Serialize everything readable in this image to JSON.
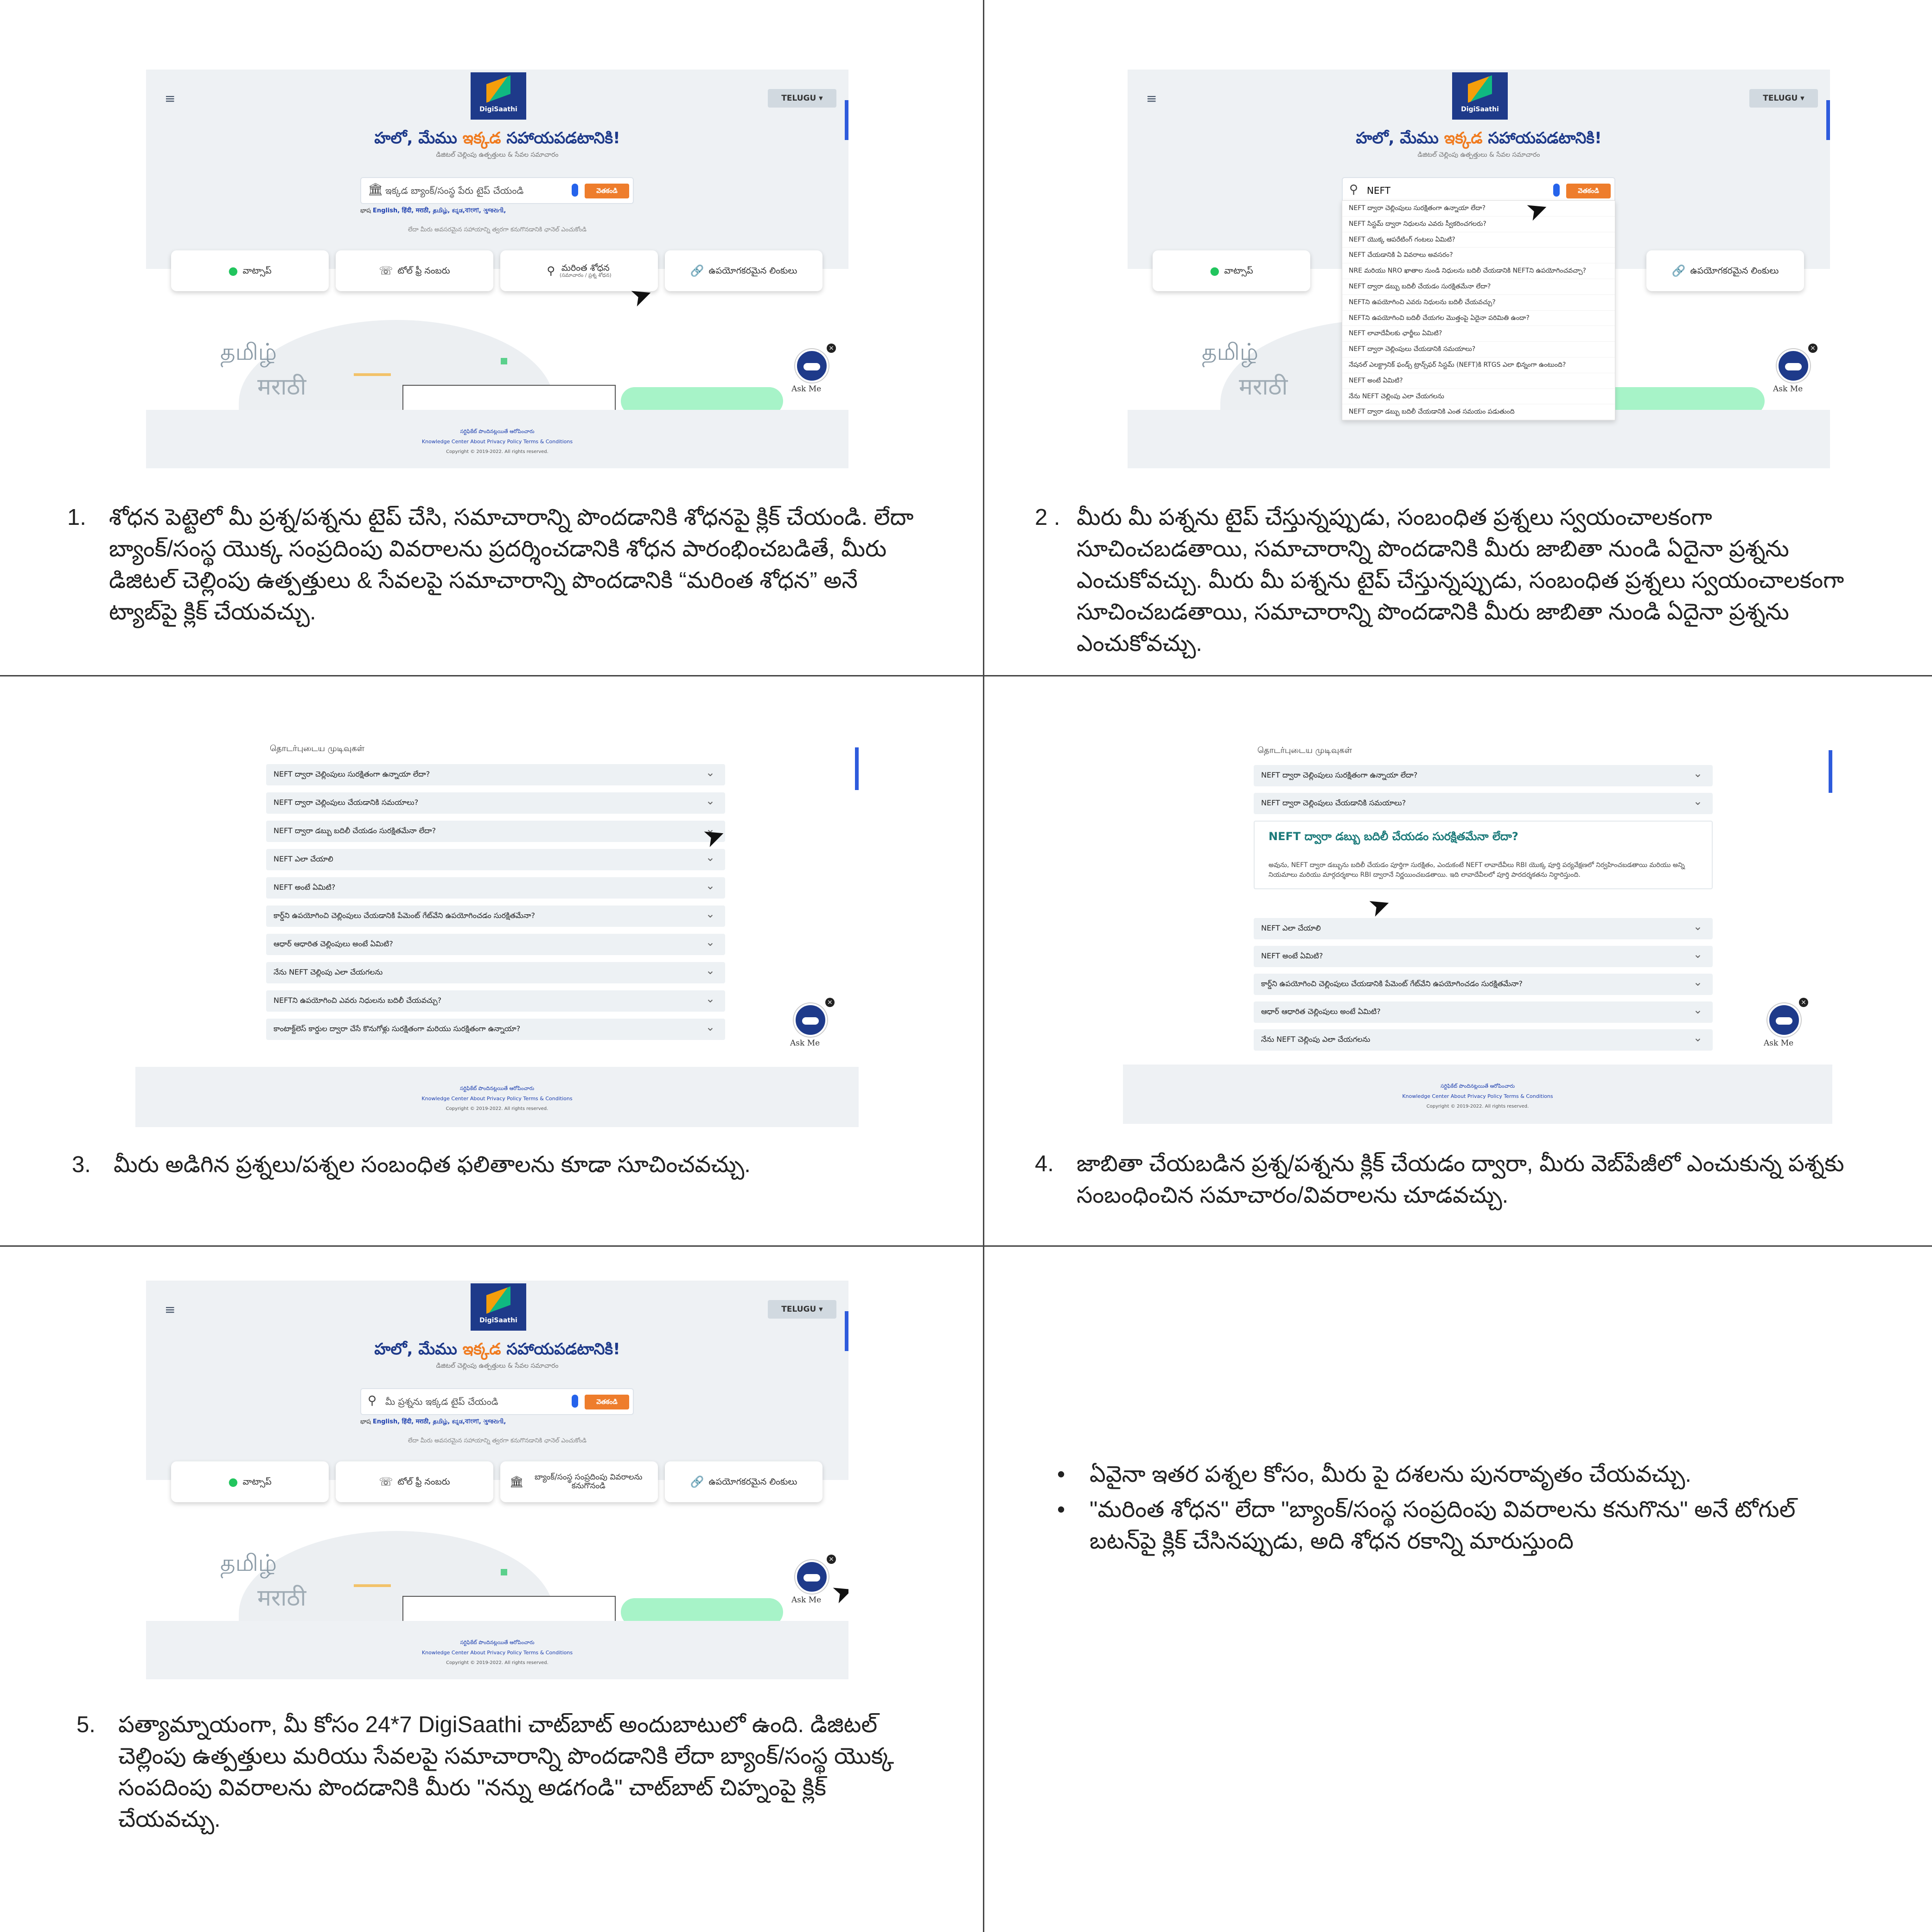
{
  "app": {
    "logo_text": "DigiSaathi",
    "lang_label": "TELUGU ▾",
    "hello_prefix": "హలో, మేము",
    "hello_highlight": "ఇక్కడ",
    "hello_suffix": "సహాయపడటానికి!",
    "subtitle": "డిజిటల్ చెల్లింపు ఉత్పత్తులు & సేవల సమాచారం",
    "search_button": "వెతకండి",
    "lang_prefix": "భాష",
    "langs": "English, हिंदी, मराठी, தமிழ், ಕನ್ನಡ,বাংলা, ગુજરાતી,",
    "hint": "లేదా మీరు అవసరమైన సహాయాన్ని త్వరగా కనుగొనడానికి ఛానెల్ ఎంచుకోండి",
    "btn_whatsapp": "వాట్సాప్",
    "btn_tollfree": "టోల్ ఫ్రీ నంబరు",
    "btn_more_search": "మరింత శోధన",
    "btn_more_search_sub": "(సమాచారం / ప్రశ్న శోధన)",
    "btn_bank_contact": "బ్యాంక్/సంస్థ సంప్రదింపు వివరాలను కనుగొనండి",
    "btn_links": "ఉపయోగకరమైన లింకులు",
    "illus_tamil": "தமிழ்",
    "illus_marathi": "मराठी",
    "ask_me": "Ask Me",
    "footer_line1": "సర్టిఫికేట్ పొందినట్లయితే    ఆరోపించారు",
    "footer_links": "Knowledge Center    About    Privacy Policy    Terms & Conditions",
    "copyright": "Copyright © 2019-2022. All rights reserved."
  },
  "panel1": {
    "search_placeholder": "ఇక్కడ బ్యాంక్/సంస్థ పేరు టైప్ చేయండి",
    "caption_num": "1.",
    "caption": "శోధన పెట్టెలో మీ ప్రశ్న/పశ్నను టైప్ చేసి, సమాచారాన్ని పొందడానికి శోధనపై క్లిక్ చేయండి. లేదా బ్యాంక్/సంస్థ యొక్క సంప్రదింపు వివరాలను ప్రదర్శించడానికి శోధన పారంభించబడితే, మీరు డిజిటల్ చెల్లింపు ఉత్పత్తులు & సేవలపై సమాచారాన్ని పొందడానికి “మరింత శోధన” అనే ట్యాబ్‌పై క్లిక్ చేయవచ్చు."
  },
  "panel2": {
    "search_value": "NEFT",
    "suggestions": [
      "NEFT ద్వారా చెల్లింపులు సురక్షితంగా ఉన్నాయా లేదా?",
      "NEFT సిస్టమ్ ద్వారా నిధులను ఎవరు స్వీకరించగలరు?",
      "NEFT యొక్క ఆపరేటింగ్ గంటలు ఏమిటి?",
      "NEFT చేయడానికి ఏ వివరాలు అవసరం?",
      "NRE మరియు NRO ఖాతాల నుండి నిధులను బదిలీ చేయడానికి NEFTని ఉపయోగించవచ్చా?",
      "NEFT ద్వారా డబ్బు బదిలీ చేయడం సురక్షితమేనా లేదా?",
      "NEFTని ఉపయోగించి ఎవరు నిధులను బదిలీ చేయవచ్చు?",
      "NEFTని ఉపయోగించి బదిలీ చేయగల మొత్తంపై ఏదైనా పరిమితి ఉందా?",
      "NEFT లావాదేవీలకు ఛార్జీలు ఏమిటి?",
      "NEFT ద్వారా చెల్లింపులు చేయడానికి సమయాలు?",
      "నేషనల్ ఎలక్ట్రానిక్ ఫండ్స్ ట్రాన్స్‌ఫర్ సిస్టమ్ (NEFT)కి RTGS ఎలా భిన్నంగా ఉంటుంది?",
      "NEFT అంటే ఏమిటి?",
      "నేను NEFT చెల్లింపు ఎలా చేయగలను",
      "NEFT ద్వారా డబ్బు బదిలీ చేయడానికి ఎంత సమయం పడుతుంది"
    ],
    "caption_num": "2 .",
    "caption": "మీరు మీ పశ్నను టైప్ చేస్తున్నప్పుడు, సంబంధిత ప్రశ్నలు స్వయంచాలకంగా సూచించబడతాయి, సమాచారాన్ని పొందడానికి మీరు జాబితా నుండి ఏదైనా ప్రశ్నను ఎంచుకోవచ్చు. మీరు మీ పశ్నను టైప్ చేస్తున్నప్పుడు, సంబంధిత ప్రశ్నలు స్వయంచాలకంగా సూచించబడతాయి, సమాచారాన్ని పొందడానికి మీరు జాబితా నుండి ఏదైనా ప్రశ్నను ఎంచుకోవచ్చు."
  },
  "panel3": {
    "faq_title": "தொடர்புடைய முடிவுகள்",
    "faqs": [
      "NEFT ద్వారా చెల్లింపులు సురక్షితంగా ఉన్నాయా లేదా?",
      "NEFT ద్వారా చెల్లింపులు చేయడానికి సమయాలు?",
      "NEFT ద్వారా డబ్బు బదిలీ చేయడం సురక్షితమేనా లేదా?",
      "NEFT ఎలా చేయాలి",
      "NEFT అంటే ఏమిటి?",
      "కార్డ్‌ని ఉపయోగించి చెల్లింపులు చేయడానికి పేమెంట్ గేట్‌వేని ఉపయోగించడం సురక్షితమేనా?",
      "ఆధార్ ఆధారిత చెల్లింపులు అంటే ఏమిటి?",
      "నేను NEFT చెల్లింపు ఎలా చేయగలను",
      "NEFTని ఉపయోగించి ఎవరు నిధులను బదిలీ చేయవచ్చు?",
      "కాంటాక్ట్‌లెస్ కార్డుల ద్వారా చేసే కొనుగోళ్లు సురక్షితంగా మరియు సురక్షితంగా ఉన్నాయా?"
    ],
    "caption_num": "3.",
    "caption": "మీరు అడిగిన ప్రశ్నలు/పశ్నల సంబంధిత ఫలితాలను కూడా సూచించవచ్చు."
  },
  "panel4": {
    "faq_title": "தொடர்புடைய முடிவுகள்",
    "faqs_top": [
      "NEFT ద్వారా చెల్లింపులు సురక్షితంగా ఉన్నాయా లేదా?",
      "NEFT ద్వారా చెల్లింపులు చేయడానికి సమయాలు?"
    ],
    "open_title": "NEFT ద్వారా డబ్బు బదిలీ చేయడం సురక్షితమేనా లేదా?",
    "open_body": "అవును, NEFT ద్వారా డబ్బును బదిలీ చేయడం పూర్తిగా సురక్షితం, ఎందుకంటే NEFT లావాదేవీలు RBI యొక్క పూర్తి పర్యవేక్షణలో నిర్వహించబడతాయి మరియు అన్ని నియమాలు మరియు మార్గదర్శకాలు RBI ద్వారానే నిర్ణయించబడతాయి. ఇది లావాదేవీలలో పూర్తి పారదర్శకతను నిర్ధారిస్తుంది.",
    "faqs_bottom": [
      "NEFT ఎలా చేయాలి",
      "NEFT అంటే ఏమిటి?",
      "కార్డ్‌ని ఉపయోగించి చెల్లింపులు చేయడానికి పేమెంట్ గేట్‌వేని ఉపయోగించడం సురక్షితమేనా?",
      "ఆధార్ ఆధారిత చెల్లింపులు అంటే ఏమిటి?",
      "నేను NEFT చెల్లింపు ఎలా చేయగలను"
    ],
    "caption_num": "4.",
    "caption": "జాబితా చేయబడిన ప్రశ్న/పశ్నను క్లిక్ చేయడం ద్వారా, మీరు వెబ్‌పేజీలో ఎంచుకున్న పశ్నకు సంబంధించిన సమాచారం/వివరాలను చూడవచ్చు."
  },
  "panel5": {
    "search_placeholder": "మీ ప్రశ్నను ఇక్కడ టైప్ చేయండి",
    "caption_num": "5.",
    "caption": "పత్యామ్నాయంగా, మీ కోసం 24*7 DigiSaathi చాట్‌బాట్ అందుబాటులో ఉంది. డిజిటల్ చెల్లింపు ఉత్పత్తులు మరియు సేవలపై సమాచారాన్ని పొందడానికి లేదా బ్యాంక్/సంస్థ యొక్క సంపదింపు వివరాలను పొందడానికి మీరు \"నన్ను అడగండి\" చాట్‌బాట్ చిహ్నంపై క్లిక్ చేయవచ్చు."
  },
  "panel6": {
    "bullets": [
      "ఏవైనా ఇతర పశ్నల కోసం, మీరు పై దశలను పునరావృతం చేయవచ్చు.",
      "\"మరింత శోధన\" లేదా \"బ్యాంక్/సంస్థ సంప్రదింపు వివరాలను కనుగొను\" అనే టోగుల్ బటన్‌పై క్లిక్ చేసినప్పుడు, అది శోధన రకాన్ని మారుస్తుంది"
    ]
  }
}
